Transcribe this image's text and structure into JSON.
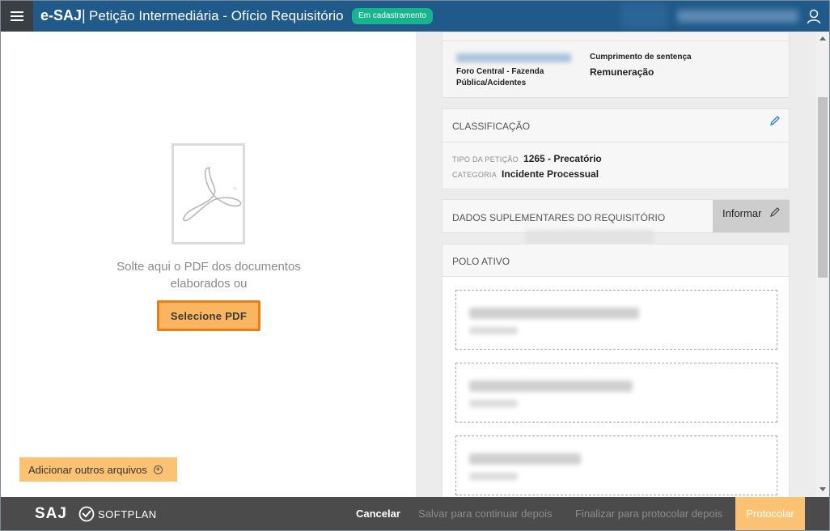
{
  "header": {
    "brand": "e-SAJ",
    "separator": "|",
    "title": "Petição Intermediária - Ofício Requisitório",
    "status_badge": "Em cadastramento"
  },
  "upload": {
    "drop_text": "Solte aqui o PDF dos documentos elaborados ou",
    "select_pdf_label": "Selecione PDF",
    "add_files_label": "Adicionar outros arquivos"
  },
  "process_card": {
    "court": "Foro Central - Fazenda Pública/Acidentes",
    "class": "Cumprimento de sentença",
    "subject": "Remuneração"
  },
  "classificacao": {
    "title": "CLASSIFICAÇÃO",
    "petition_type_label": "TIPO DA PETIÇÃO",
    "petition_type_value": "1265 - Precatório",
    "category_label": "CATEGORIA",
    "category_value": "Incidente Processual"
  },
  "dados_suplementares": {
    "title": "DADOS SUPLEMENTARES DO REQUISITÓRIO",
    "informar_label": "Informar"
  },
  "polo_ativo": {
    "title": "POLO ATIVO",
    "parties_count_visible": 3
  },
  "footer": {
    "saj_logo": "SAJ",
    "softplan_logo": "SOFTPLAN",
    "cancel_label": "Cancelar",
    "save_later_label": "Salvar para continuar depois",
    "finalize_label": "Finalizar para protocolar depois",
    "protocol_label": "Protocolar"
  },
  "colors": {
    "header_bg": "#1f5a8a",
    "badge": "#17b58c",
    "accent_orange": "#fbb45f",
    "accent_orange_border": "#e97f17",
    "footer_bg": "#4b4b4b"
  },
  "icons": [
    "hamburger-menu-icon",
    "user-icon",
    "pdf-file-icon",
    "add-circle-icon",
    "pencil-edit-icon",
    "saj-logo",
    "softplan-logo"
  ]
}
